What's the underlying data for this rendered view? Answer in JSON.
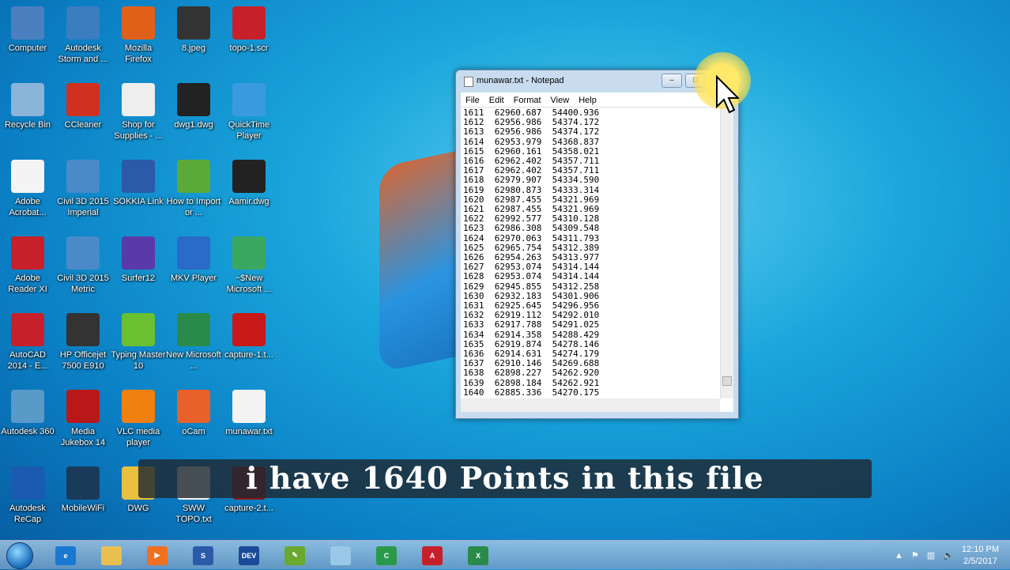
{
  "desktop_icons": [
    {
      "label": "Computer",
      "color": "#4a7fc0"
    },
    {
      "label": "Autodesk Storm and ...",
      "color": "#3a7ec0"
    },
    {
      "label": "Mozilla Firefox",
      "color": "#e0601a"
    },
    {
      "label": "8.jpeg",
      "color": "#333"
    },
    {
      "label": "topo-1.scr",
      "color": "#c8202a"
    },
    {
      "label": "Recycle Bin",
      "color": "#8ab4d8"
    },
    {
      "label": "CCleaner",
      "color": "#d03020"
    },
    {
      "label": "Shop for Supplies - ...",
      "color": "#eee"
    },
    {
      "label": "dwg1.dwg",
      "color": "#222"
    },
    {
      "label": "QuickTime Player",
      "color": "#3a9ae0"
    },
    {
      "label": "Adobe Acrobat...",
      "color": "#f4f4f4"
    },
    {
      "label": "Civil 3D 2015 Imperial",
      "color": "#4a8ac8"
    },
    {
      "label": "SOKKIA Link",
      "color": "#2a5aa8"
    },
    {
      "label": "How to Import or ...",
      "color": "#5aaa3a"
    },
    {
      "label": "Aamir.dwg",
      "color": "#222"
    },
    {
      "label": "Adobe Reader XI",
      "color": "#c8202a"
    },
    {
      "label": "Civil 3D 2015 Metric",
      "color": "#4a8ac8"
    },
    {
      "label": "Surfer12",
      "color": "#5a3aa8"
    },
    {
      "label": "MKV Player",
      "color": "#2a6ac8"
    },
    {
      "label": "~$New Microsoft ...",
      "color": "#3aa860"
    },
    {
      "label": "AutoCAD 2014 - E...",
      "color": "#c8202a"
    },
    {
      "label": "HP Officejet 7500 E910",
      "color": "#333"
    },
    {
      "label": "Typing Master 10",
      "color": "#6ac030"
    },
    {
      "label": "New Microsoft ...",
      "color": "#2a8a4a"
    },
    {
      "label": "capture-1.t...",
      "color": "#c81818"
    },
    {
      "label": "Autodesk 360",
      "color": "#5a9ac8"
    },
    {
      "label": "Media Jukebox 14",
      "color": "#b81818"
    },
    {
      "label": "VLC media player",
      "color": "#f08010"
    },
    {
      "label": "oCam",
      "color": "#e8602a"
    },
    {
      "label": "munawar.txt",
      "color": "#f4f4f4"
    },
    {
      "label": "Autodesk ReCap",
      "color": "#1a5ab0"
    },
    {
      "label": "MobileWiFi",
      "color": "#1a3a5a"
    },
    {
      "label": "DWG",
      "color": "#e8c040"
    },
    {
      "label": "SWW TOPO.txt",
      "color": "#f4f4f4"
    },
    {
      "label": "capture-2.t...",
      "color": "#8a1818"
    }
  ],
  "notepad": {
    "title": "munawar.txt - Notepad",
    "menu": [
      "File",
      "Edit",
      "Format",
      "View",
      "Help"
    ],
    "lines": [
      "1611  62960.687  54400.936",
      "1612  62956.986  54374.172",
      "1613  62956.986  54374.172",
      "1614  62953.979  54368.837",
      "1615  62960.161  54358.021",
      "1616  62962.402  54357.711",
      "1617  62962.402  54357.711",
      "1618  62979.907  54334.590",
      "1619  62980.873  54333.314",
      "1620  62987.455  54321.969",
      "1621  62987.455  54321.969",
      "1622  62992.577  54310.128",
      "1623  62986.308  54309.548",
      "1624  62970.063  54311.793",
      "1625  62965.754  54312.389",
      "1626  62954.263  54313.977",
      "1627  62953.074  54314.144",
      "1628  62953.074  54314.144",
      "1629  62945.855  54312.258",
      "1630  62932.183  54301.906",
      "1631  62925.645  54296.956",
      "1632  62919.112  54292.010",
      "1633  62917.788  54291.025",
      "1634  62914.358  54288.429",
      "1635  62919.874  54278.146",
      "1636  62914.631  54274.179",
      "1637  62910.146  54269.688",
      "1638  62898.227  54262.920",
      "1639  62898.184  54262.921",
      "1640  62885.336  54270.175"
    ]
  },
  "caption": "i have 1640 Points in this file",
  "taskbar": {
    "items": [
      {
        "name": "internet-explorer",
        "glyph": "e",
        "color": "#1a78d0"
      },
      {
        "name": "windows-explorer",
        "glyph": "",
        "color": "#e8c050"
      },
      {
        "name": "media-player",
        "glyph": "▶",
        "color": "#f07020"
      },
      {
        "name": "sokkia",
        "glyph": "S",
        "color": "#2a5aa8"
      },
      {
        "name": "dev",
        "glyph": "DEV",
        "color": "#1a4a9a"
      },
      {
        "name": "app-green",
        "glyph": "✎",
        "color": "#6aa830"
      },
      {
        "name": "notepad",
        "glyph": "",
        "color": "#9ac8e8"
      },
      {
        "name": "civil3d",
        "glyph": "C",
        "color": "#2a9a4a"
      },
      {
        "name": "autocad",
        "glyph": "A",
        "color": "#c8202a"
      },
      {
        "name": "excel",
        "glyph": "X",
        "color": "#2a8a4a"
      }
    ],
    "time": "12:10 PM",
    "date": "2/5/2017"
  }
}
